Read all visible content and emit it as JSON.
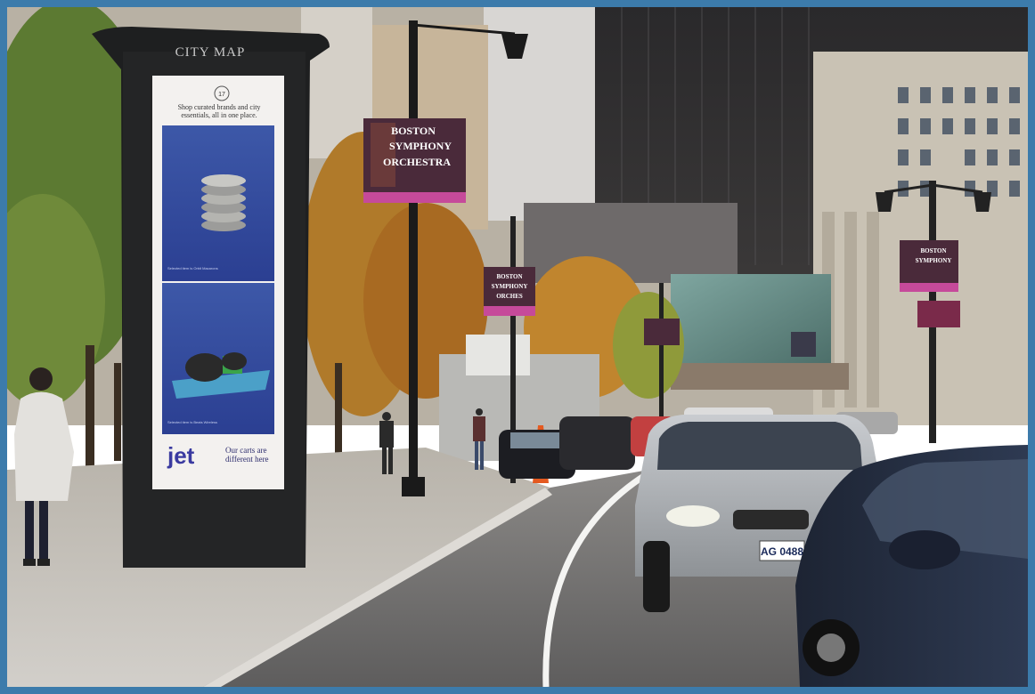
{
  "photo": {
    "frame_color": "#3c7bab",
    "kiosk": {
      "header": "CITY MAP",
      "ad": {
        "badge": "17",
        "tagline": "Shop curated brands and city essentials, all in one place.",
        "caption_top": "Selected item is Orbit Macarons",
        "caption_bottom": "Selected item is Beats Wireless",
        "brand": "jet",
        "slogan": "Our carts are different here"
      }
    },
    "banners": [
      {
        "line1": "BOSTON",
        "line2": "SYMPHONY",
        "line3": "ORCHESTRA"
      },
      {
        "line1": "BOSTON",
        "line2": "SYMPHONY",
        "line3": "ORCHES"
      },
      {
        "line1": "BOSTON",
        "line2": "SYMPHONY",
        "line3": ""
      }
    ],
    "plate": "AG 0488",
    "colors": {
      "sky_building": "#2e2c2e",
      "sidewalk": "#c9c6c0",
      "road": "#6d6c6c",
      "ad_blue": "#30449a",
      "banner_maroon": "#4a2a3a",
      "banner_pink": "#c64a9a"
    }
  }
}
